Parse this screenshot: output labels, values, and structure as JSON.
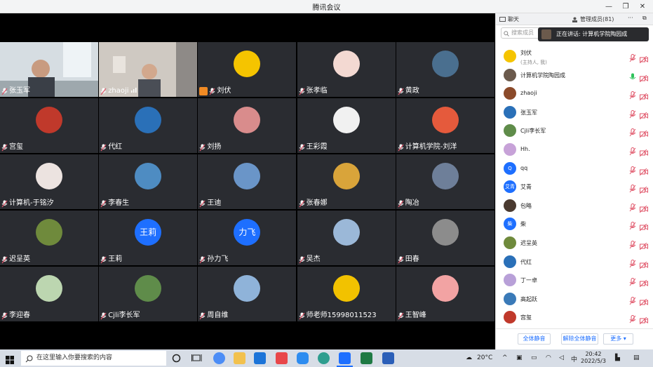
{
  "window": {
    "title": "腾讯会议"
  },
  "tiles": [
    {
      "name": "张玉军",
      "type": "cam",
      "variant": 1,
      "host": false,
      "signal": false
    },
    {
      "name": "zhaoji",
      "type": "cam",
      "variant": 2,
      "host": false,
      "signal": true
    },
    {
      "name": "刘伏",
      "type": "avatar",
      "color": "#f5c400",
      "host": true,
      "signal": false
    },
    {
      "name": "张孝临",
      "type": "avatar",
      "color": "#f3d9d2",
      "host": false,
      "signal": false
    },
    {
      "name": "黄政",
      "type": "avatar",
      "color": "#4a6f8f",
      "host": false,
      "signal": false
    },
    {
      "name": "宫玺",
      "type": "avatar",
      "color": "#c0392b",
      "host": false,
      "signal": false
    },
    {
      "name": "代红",
      "type": "avatar",
      "color": "#2a70b8",
      "host": false,
      "signal": false
    },
    {
      "name": "刘扬",
      "type": "avatar",
      "color": "#d98c8c",
      "host": false,
      "signal": false
    },
    {
      "name": "王彩霞",
      "type": "avatar",
      "color": "#f1f1f1",
      "host": false,
      "signal": false
    },
    {
      "name": "计算机学院-刘洋",
      "type": "avatar",
      "color": "#e55a3c",
      "host": false,
      "signal": false
    },
    {
      "name": "计算机-于铭汐",
      "type": "avatar",
      "color": "#ece3e0",
      "host": false,
      "signal": false
    },
    {
      "name": "李春生",
      "type": "avatar",
      "color": "#4e8cc2",
      "host": false,
      "signal": false
    },
    {
      "name": "王迪",
      "type": "avatar",
      "color": "#6a95c8",
      "host": false,
      "signal": false
    },
    {
      "name": "张春娜",
      "type": "avatar",
      "color": "#d9a43a",
      "host": false,
      "signal": false
    },
    {
      "name": "陶冶",
      "type": "avatar",
      "color": "#6e7f99",
      "host": false,
      "signal": false
    },
    {
      "name": "迟呈英",
      "type": "avatar",
      "color": "#6f8a3c",
      "host": false,
      "signal": false
    },
    {
      "name": "王莉",
      "type": "text",
      "text": "王莉",
      "color": "#1e6fff",
      "host": false,
      "signal": false
    },
    {
      "name": "孙力飞",
      "type": "text",
      "text": "力飞",
      "color": "#1e6fff",
      "host": false,
      "signal": false
    },
    {
      "name": "吴杰",
      "type": "avatar",
      "color": "#9bb8d8",
      "host": false,
      "signal": false
    },
    {
      "name": "田春",
      "type": "avatar",
      "color": "#8c8c8c",
      "host": false,
      "signal": false
    },
    {
      "name": "李迎春",
      "type": "avatar",
      "color": "#bcd6b0",
      "host": false,
      "signal": false
    },
    {
      "name": "Cjli李长军",
      "type": "avatar",
      "color": "#5f8c4a",
      "host": false,
      "signal": false
    },
    {
      "name": "周自维",
      "type": "avatar",
      "color": "#8fb3d9",
      "host": false,
      "signal": false
    },
    {
      "name": "师老师15998011523",
      "type": "avatar",
      "color": "#f2c200",
      "host": false,
      "signal": false
    },
    {
      "name": "王智峰",
      "type": "avatar",
      "color": "#f2a3a3",
      "host": false,
      "signal": false
    }
  ],
  "panel": {
    "tab_chat": "聊天",
    "tab_members": "管理成员(81)",
    "more": "···",
    "search_placeholder": "搜索成员",
    "speaking": "正在讲话: 计算机学院陶园成",
    "members": [
      {
        "name": "刘伏",
        "sub": "(主持人, 我)",
        "color": "#f5c400",
        "text": "",
        "mic": "muted"
      },
      {
        "name": "计算机学院陶园成",
        "sub": "",
        "color": "#6b5a4c",
        "text": "",
        "mic": "active"
      },
      {
        "name": "zhaoji",
        "sub": "",
        "color": "#8b4a2a",
        "text": "",
        "mic": "muted"
      },
      {
        "name": "张玉军",
        "sub": "",
        "color": "#2a70b8",
        "text": "",
        "mic": "muted"
      },
      {
        "name": "Cjli李长军",
        "sub": "",
        "color": "#5f8c4a",
        "text": "",
        "mic": "muted"
      },
      {
        "name": "Hh.",
        "sub": "",
        "color": "#c7a2d8",
        "text": "",
        "mic": "muted"
      },
      {
        "name": "qq",
        "sub": "",
        "color": "#1e6fff",
        "text": "Q",
        "mic": "muted"
      },
      {
        "name": "艾青",
        "sub": "",
        "color": "#1e6fff",
        "text": "艾青",
        "mic": "muted"
      },
      {
        "name": "包略",
        "sub": "",
        "color": "#4a3a30",
        "text": "",
        "mic": "muted"
      },
      {
        "name": "柴",
        "sub": "",
        "color": "#1e6fff",
        "text": "柴",
        "mic": "muted"
      },
      {
        "name": "迟呈英",
        "sub": "",
        "color": "#6f8a3c",
        "text": "",
        "mic": "muted"
      },
      {
        "name": "代红",
        "sub": "",
        "color": "#2a70b8",
        "text": "",
        "mic": "muted"
      },
      {
        "name": "丁一卓",
        "sub": "",
        "color": "#b8a0d8",
        "text": "",
        "mic": "muted"
      },
      {
        "name": "高起跃",
        "sub": "",
        "color": "#3a7ab8",
        "text": "",
        "mic": "muted"
      },
      {
        "name": "宫玺",
        "sub": "",
        "color": "#c0392b",
        "text": "",
        "mic": "muted"
      }
    ],
    "btn_mute_all": "全体静音",
    "btn_unmute_all": "解除全体静音",
    "btn_more": "更多 ▾"
  },
  "taskbar": {
    "search_placeholder": "在这里输入你要搜索的内容",
    "temperature": "20°C",
    "ime": "中",
    "time": "20:42",
    "date": "2022/5/3"
  },
  "colors": {
    "accent": "#1e6fff",
    "tile_bg": "#2a2c31",
    "mic_muted": "#e0566a",
    "mic_active": "#2ec25b"
  }
}
